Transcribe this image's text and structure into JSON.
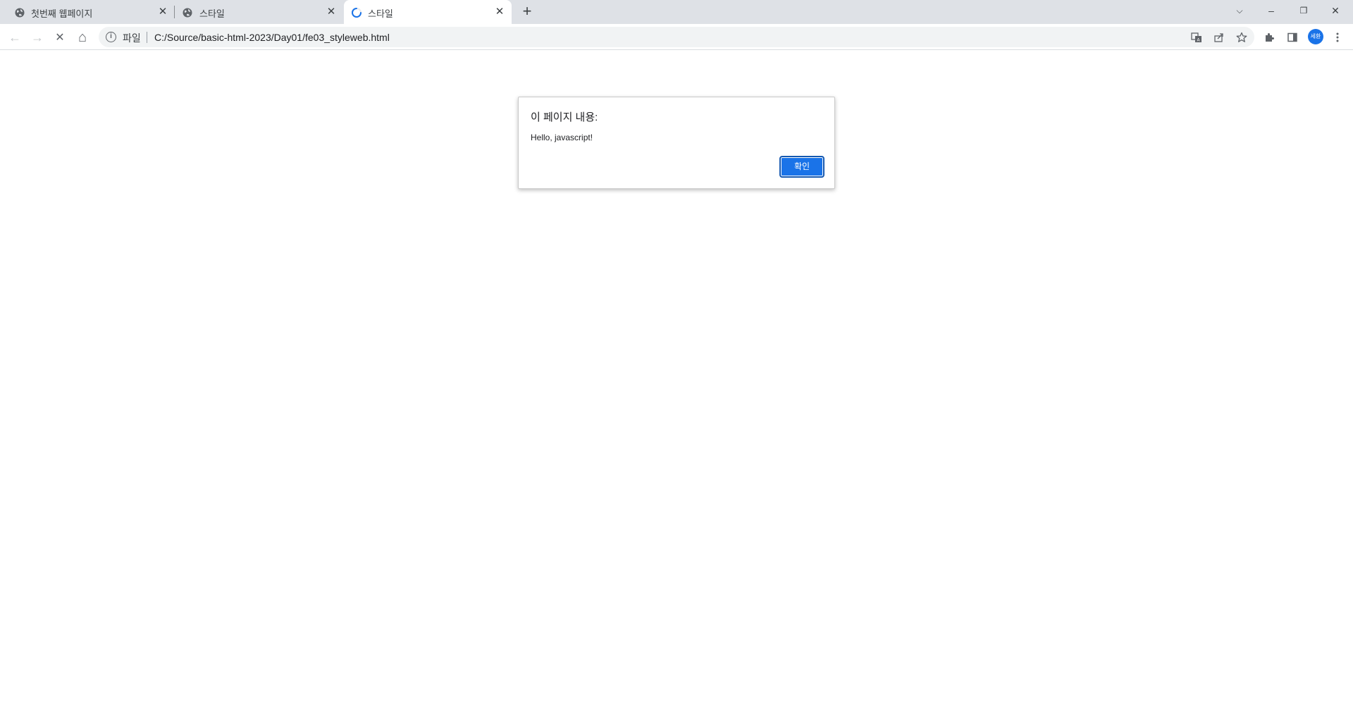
{
  "tabs": [
    {
      "title": "첫번째 웹페이지",
      "icon": "globe-icon",
      "active": false
    },
    {
      "title": "스타일",
      "icon": "globe-icon",
      "active": false
    },
    {
      "title": "스타일",
      "icon": "loading-spinner-icon",
      "active": true
    }
  ],
  "new_tab_label": "+",
  "window_controls": {
    "tab_search": "⌵",
    "minimize": "–",
    "restore": "❐",
    "close": "✕"
  },
  "toolbar": {
    "back": "←",
    "forward": "→",
    "stop": "✕",
    "home": "⌂"
  },
  "omnibox": {
    "scheme_label": "파일",
    "url": "C:/Source/basic-html-2023/Day01/fe03_styleweb.html"
  },
  "profile": {
    "initials": "세환",
    "color": "#1a73e8"
  },
  "dialog": {
    "title": "이 페이지 내용:",
    "message": "Hello, javascript!",
    "ok_label": "확인"
  },
  "colors": {
    "accent": "#1a73e8",
    "tabstrip": "#dee1e6"
  }
}
